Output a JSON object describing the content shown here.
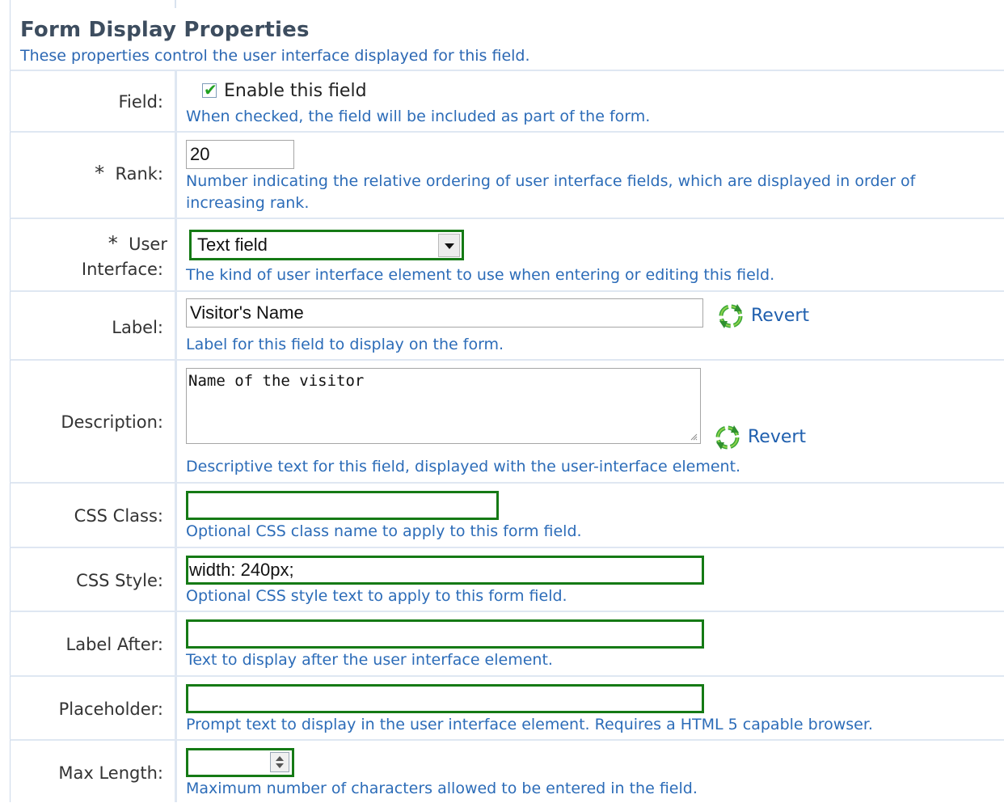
{
  "section": {
    "title": "Form Display Properties",
    "subtitle": "These properties control the user interface displayed for this field."
  },
  "fields": {
    "enabled": {
      "label": "Field:",
      "checked": true,
      "checkbox_label": "Enable this field",
      "hint": "When checked, the field will be included as part of the form."
    },
    "rank": {
      "required_mark": "*",
      "label": "Rank:",
      "value": "20",
      "hint_line1": "Number indicating the relative ordering of user interface fields, which are displayed in order of",
      "hint_line2": "increasing rank."
    },
    "user_interface": {
      "required_mark": "*",
      "label_line1": "User",
      "label_line2": "Interface:",
      "selected": "Text field",
      "hint": "The kind of user interface element to use when entering or editing this field."
    },
    "label": {
      "label": "Label:",
      "value": "Visitor's Name",
      "revert": "Revert",
      "hint": "Label for this field to display on the form."
    },
    "description": {
      "label": "Description:",
      "value": "Name of the visitor",
      "revert": "Revert",
      "hint": "Descriptive text for this field, displayed with the user-interface element."
    },
    "css_class": {
      "label": "CSS Class:",
      "value": "",
      "hint": "Optional CSS class name to apply to this form field."
    },
    "css_style": {
      "label": "CSS Style:",
      "value": "width: 240px;",
      "hint": "Optional CSS style text to apply to this form field."
    },
    "label_after": {
      "label": "Label After:",
      "value": "",
      "hint": "Text to display after the user interface element."
    },
    "placeholder": {
      "label": "Placeholder:",
      "value": "",
      "hint": "Prompt text to display in the user interface element. Requires a HTML 5 capable browser."
    },
    "max_length": {
      "label": "Max Length:",
      "value": "",
      "hint": "Maximum number of characters allowed to be entered in the field."
    }
  },
  "icons": {
    "revert": "refresh-cycle-icon",
    "checkbox": "checkmark-icon",
    "select_arrow": "chevron-down-icon",
    "spinner": "spinner-arrows-icon"
  },
  "colors": {
    "hint_text": "#2c6cb8",
    "focus_border": "#157a15",
    "divider": "#dfe7f2"
  }
}
